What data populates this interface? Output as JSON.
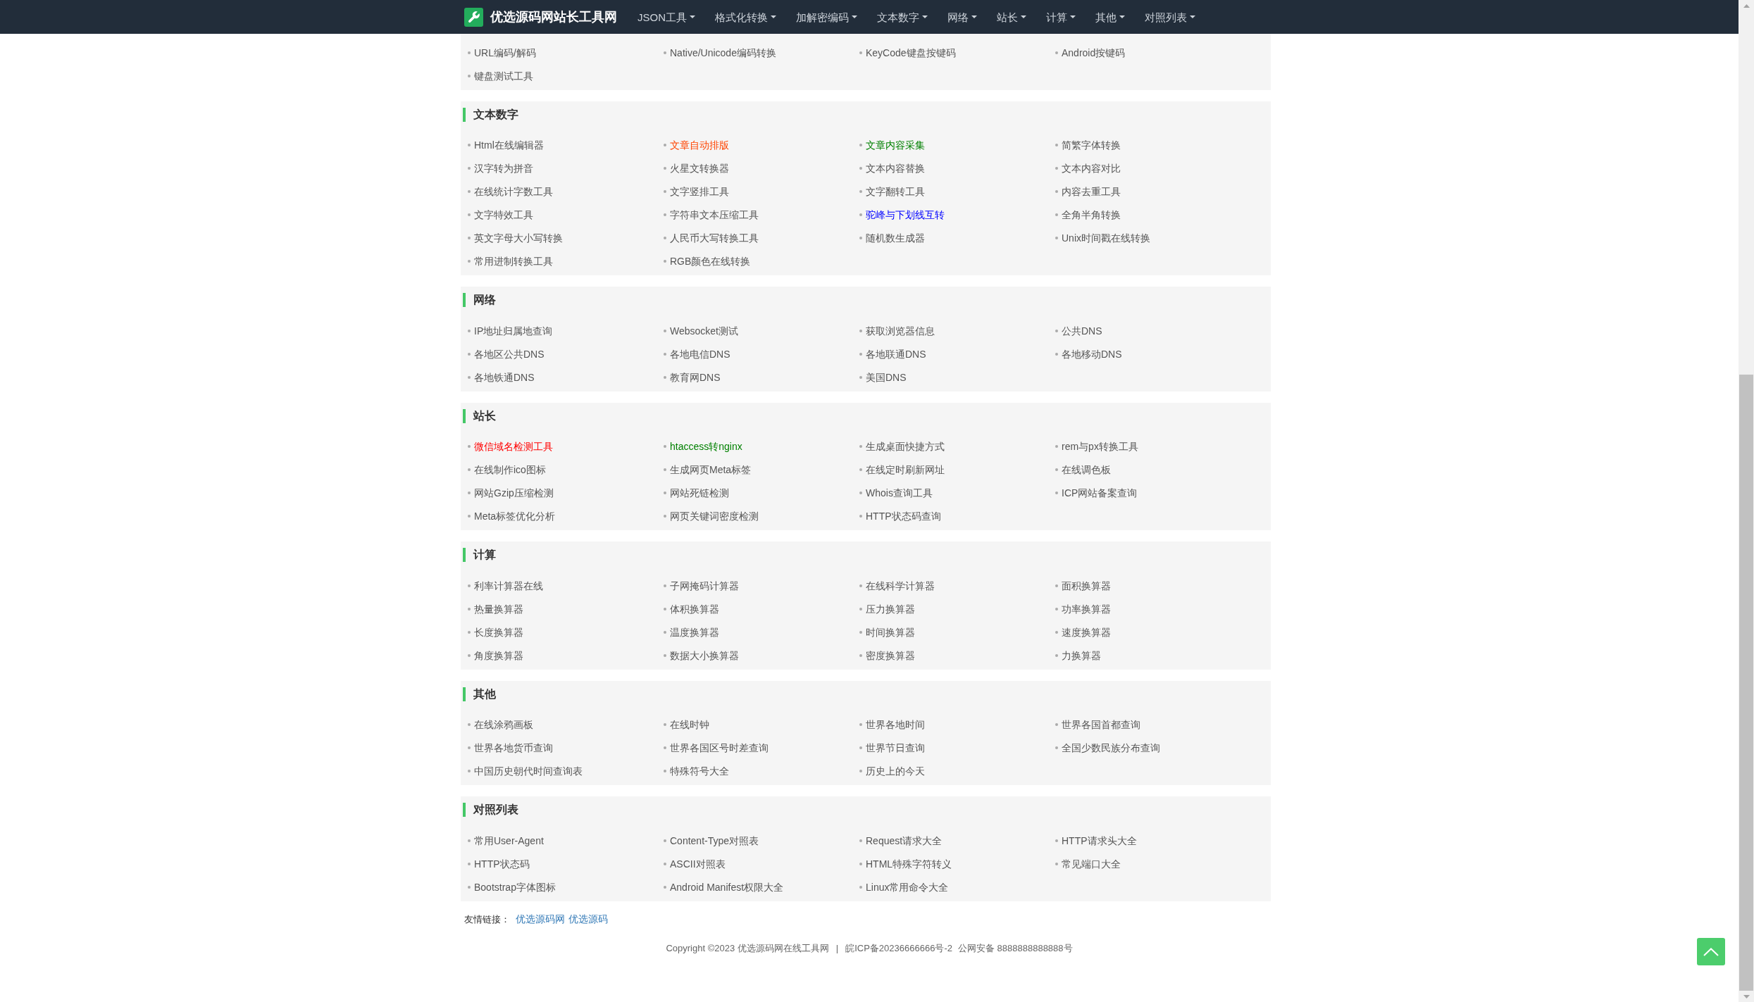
{
  "nav": {
    "site_title": "优选源码网站长工具网",
    "menu": [
      "JSON工具",
      "格式化转换",
      "加解密编码",
      "文本数字",
      "网络",
      "站长",
      "计算",
      "其他",
      "对照列表"
    ]
  },
  "sections": [
    {
      "items": [
        {
          "label": "URL编码/解码"
        },
        {
          "label": "Native/Unicode编码转换"
        },
        {
          "label": "KeyCode键盘按键码"
        },
        {
          "label": "Android按键码"
        },
        {
          "label": "键盘测试工具"
        }
      ]
    },
    {
      "title": "文本数字",
      "items": [
        {
          "label": "Html在线编辑器"
        },
        {
          "label": "文章自动排版",
          "color": "#ff4400"
        },
        {
          "label": "文章内容采集",
          "color": "#008000"
        },
        {
          "label": "简繁字体转换"
        },
        {
          "label": "汉字转为拼音"
        },
        {
          "label": "火星文转换器"
        },
        {
          "label": "文本内容替换"
        },
        {
          "label": "文本内容对比"
        },
        {
          "label": "在线统计字数工具"
        },
        {
          "label": "文字竖排工具"
        },
        {
          "label": "文字翻转工具"
        },
        {
          "label": "内容去重工具"
        },
        {
          "label": "文字特效工具"
        },
        {
          "label": "字符串文本压缩工具"
        },
        {
          "label": "驼峰与下划线互转",
          "color": "#0000ff"
        },
        {
          "label": "全角半角转换"
        },
        {
          "label": "英文字母大小写转换"
        },
        {
          "label": "人民币大写转换工具"
        },
        {
          "label": "随机数生成器"
        },
        {
          "label": "Unix时间戳在线转换"
        },
        {
          "label": "常用进制转换工具"
        },
        {
          "label": "RGB颜色在线转换"
        }
      ]
    },
    {
      "title": "网络",
      "items": [
        {
          "label": "IP地址归属地查询"
        },
        {
          "label": "Websocket测试"
        },
        {
          "label": "获取浏览器信息"
        },
        {
          "label": "公共DNS"
        },
        {
          "label": "各地区公共DNS"
        },
        {
          "label": "各地电信DNS"
        },
        {
          "label": "各地联通DNS"
        },
        {
          "label": "各地移动DNS"
        },
        {
          "label": "各地铁通DNS"
        },
        {
          "label": "教育网DNS"
        },
        {
          "label": "美国DNS"
        }
      ]
    },
    {
      "title": "站长",
      "items": [
        {
          "label": "微信域名检测工具",
          "color": "#ff0000"
        },
        {
          "label": "htaccess转nginx",
          "color": "#008000"
        },
        {
          "label": "生成桌面快捷方式"
        },
        {
          "label": "rem与px转换工具"
        },
        {
          "label": "在线制作ico图标"
        },
        {
          "label": "生成网页Meta标签"
        },
        {
          "label": "在线定时刷新网址"
        },
        {
          "label": "在线调色板"
        },
        {
          "label": "网站Gzip压缩检测"
        },
        {
          "label": "网站死链检测"
        },
        {
          "label": "Whois查询工具"
        },
        {
          "label": "ICP网站备案查询"
        },
        {
          "label": "Meta标签优化分析"
        },
        {
          "label": "网页关键词密度检测"
        },
        {
          "label": "HTTP状态码查询"
        }
      ]
    },
    {
      "title": "计算",
      "items": [
        {
          "label": "利率计算器在线"
        },
        {
          "label": "子网掩码计算器"
        },
        {
          "label": "在线科学计算器"
        },
        {
          "label": "面积换算器"
        },
        {
          "label": "热量换算器"
        },
        {
          "label": "体积换算器"
        },
        {
          "label": "压力换算器"
        },
        {
          "label": "功率换算器"
        },
        {
          "label": "长度换算器"
        },
        {
          "label": "温度换算器"
        },
        {
          "label": "时间换算器"
        },
        {
          "label": "速度换算器"
        },
        {
          "label": "角度换算器"
        },
        {
          "label": "数据大小换算器"
        },
        {
          "label": "密度换算器"
        },
        {
          "label": "力换算器"
        }
      ]
    },
    {
      "title": "其他",
      "items": [
        {
          "label": "在线涂鸦画板"
        },
        {
          "label": "在线时钟"
        },
        {
          "label": "世界各地时间"
        },
        {
          "label": "世界各国首都查询"
        },
        {
          "label": "世界各地货币查询"
        },
        {
          "label": "世界各国区号时差查询"
        },
        {
          "label": "世界节日查询"
        },
        {
          "label": "全国少数民族分布查询"
        },
        {
          "label": "中国历史朝代时间查询表"
        },
        {
          "label": "特殊符号大全"
        },
        {
          "label": "历史上的今天"
        }
      ]
    },
    {
      "title": "对照列表",
      "items": [
        {
          "label": "常用User-Agent"
        },
        {
          "label": "Content-Type对照表"
        },
        {
          "label": "Request请求大全"
        },
        {
          "label": "HTTP请求头大全"
        },
        {
          "label": "HTTP状态码"
        },
        {
          "label": "ASCII对照表"
        },
        {
          "label": "HTML特殊字符转义"
        },
        {
          "label": "常见端口大全"
        },
        {
          "label": "Bootstrap字体图标"
        },
        {
          "label": "Android Manifest权限大全"
        },
        {
          "label": "Linux常用命令大全"
        }
      ]
    }
  ],
  "friend_links": {
    "label": "友情链接：",
    "links": [
      "优选源码网",
      "优选源码"
    ]
  },
  "footer": {
    "copyright": "Copyright ©2023 优选源码网在线工具网",
    "separator": "|",
    "icp": "皖ICP备20236666666号-2",
    "police": "公网安备 8888888888888号"
  }
}
